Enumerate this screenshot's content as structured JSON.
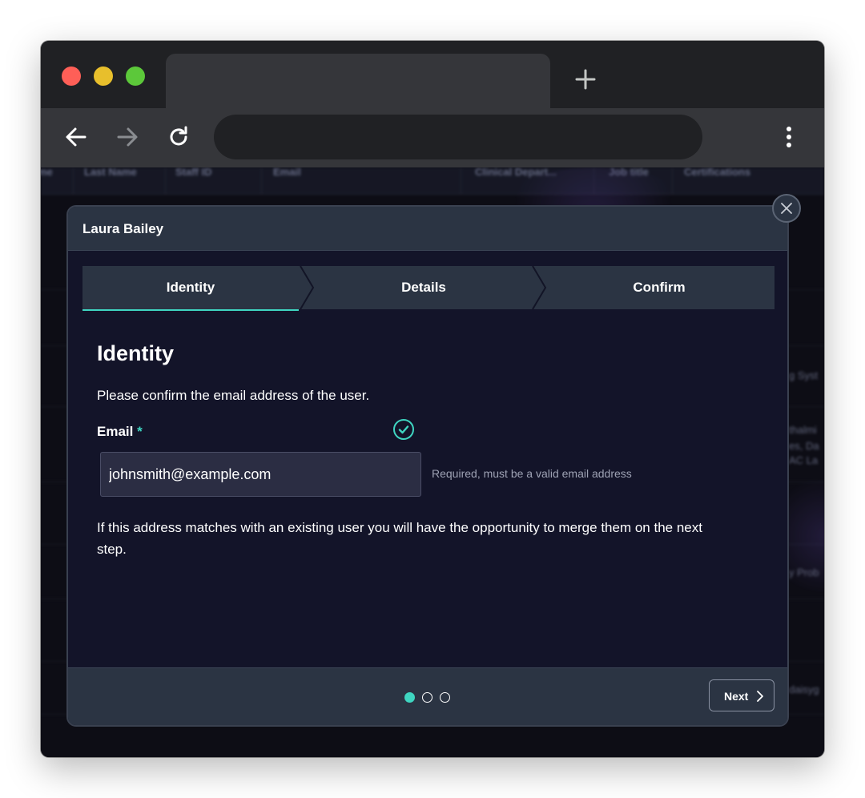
{
  "browser": {
    "tab_title": "",
    "address": ""
  },
  "background_table": {
    "columns": [
      "me",
      "Last Name",
      "Staff ID",
      "Email",
      "Clinical Depart...",
      "Job title",
      "Certifications"
    ],
    "fragments": [
      "g Syst",
      "thalmi",
      "es, Da",
      "AC La",
      "y Prob",
      "daisyg"
    ]
  },
  "modal": {
    "title": "Laura Bailey",
    "steps": [
      "Identity",
      "Details",
      "Confirm"
    ],
    "active_step": 0,
    "heading": "Identity",
    "description": "Please confirm the email address of the user.",
    "email_label": "Email",
    "required_mark": "*",
    "email_value": "johnsmith@example.com",
    "email_hint": "Required, must be a valid email address",
    "note": "If this address matches with an existing user you will have the opportunity to merge them on the next step.",
    "next_label": "Next",
    "pages_total": 3,
    "current_page": 1
  },
  "colors": {
    "accent": "#3fd5c1",
    "modal_bg": "#131429",
    "panel_bg": "#2b3443"
  }
}
